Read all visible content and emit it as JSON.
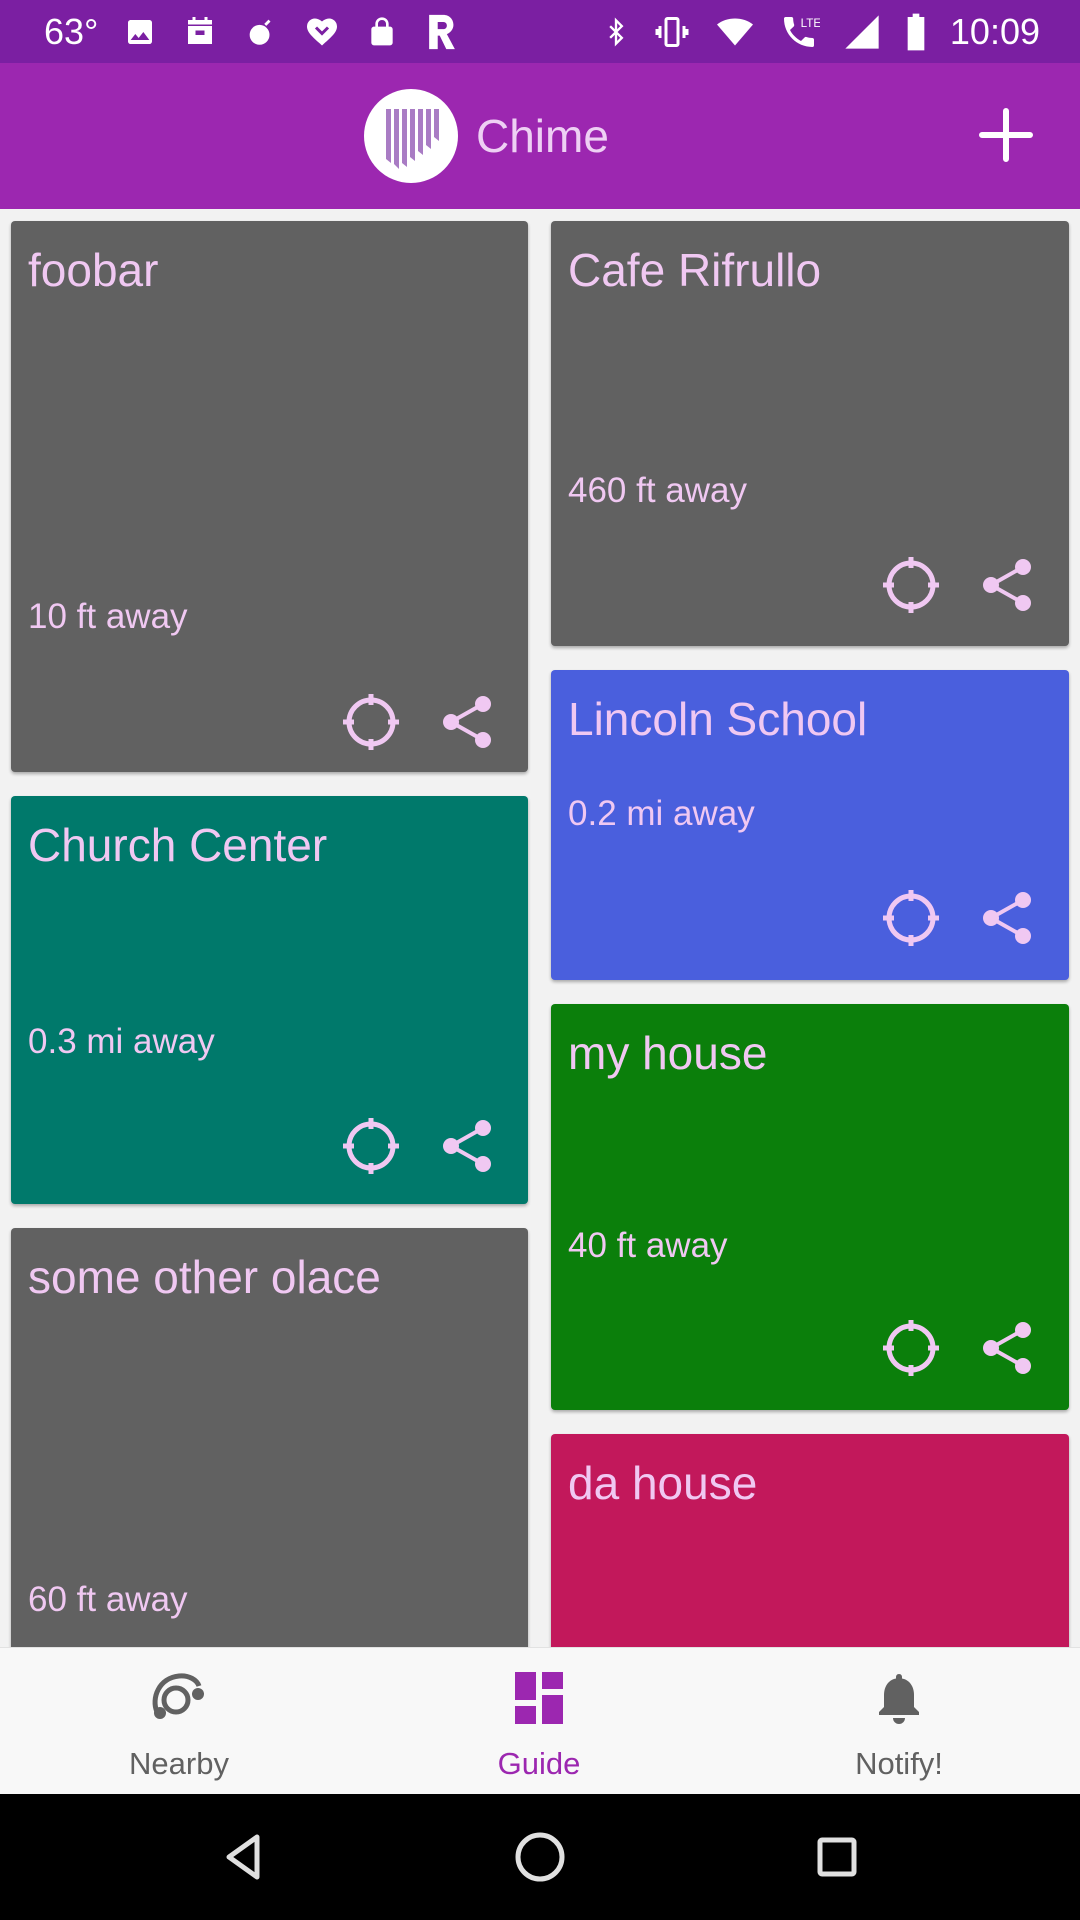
{
  "status_bar": {
    "temperature": "63°",
    "time": "10:09",
    "network_label": "LTE",
    "left_icons": [
      "image-icon",
      "calendar-icon",
      "bomb-icon",
      "heart-app-icon",
      "lock-icon",
      "r-app-icon"
    ],
    "right_icons": [
      "bluetooth-icon",
      "vibrate-icon",
      "wifi-icon",
      "call-lte-icon",
      "signal-icon",
      "battery-icon"
    ]
  },
  "app_bar": {
    "title": "Chime",
    "add_icon": "plus-icon",
    "color": "#9c27b0"
  },
  "cards": [
    {
      "name": "foobar",
      "distance": "10 ft away",
      "color": "#616161"
    },
    {
      "name": "Church Center",
      "distance": "0.3 mi away",
      "color": "#00796b"
    },
    {
      "name": "some other olace",
      "distance": "60 ft away",
      "color": "#616161"
    },
    {
      "name": "Cafe Rifrullo",
      "distance": "460 ft away",
      "color": "#616161"
    },
    {
      "name": "Lincoln School",
      "distance": "0.2 mi away",
      "color": "#4a5fdd"
    },
    {
      "name": "my house",
      "distance": "40 ft away",
      "color": "#0b7f0b"
    },
    {
      "name": "da house",
      "distance": "",
      "color": "#c2185b"
    }
  ],
  "card_actions": [
    "locate-icon",
    "share-icon"
  ],
  "bottom_nav": {
    "items": [
      {
        "label": "Nearby",
        "icon": "nearby-icon",
        "active": false
      },
      {
        "label": "Guide",
        "icon": "dashboard-icon",
        "active": true
      },
      {
        "label": "Notify!",
        "icon": "bell-icon",
        "active": false
      }
    ],
    "active_color": "#9c27b0",
    "inactive_color": "#616161"
  },
  "system_nav": [
    "back-icon",
    "home-icon",
    "recents-icon"
  ]
}
